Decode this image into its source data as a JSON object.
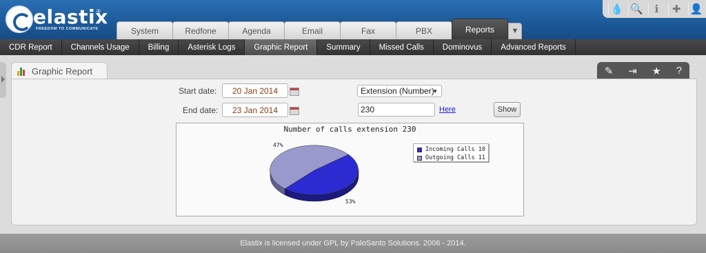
{
  "brand": {
    "name": "elastix",
    "reg": "®",
    "tagline": "FREEDOM TO COMMUNICATE"
  },
  "tools": [
    {
      "name": "drop-icon",
      "glyph": "💧"
    },
    {
      "name": "search-icon",
      "glyph": "🔍"
    },
    {
      "name": "info-icon",
      "glyph": "ℹ"
    },
    {
      "name": "puzzle-icon",
      "glyph": "✚"
    },
    {
      "name": "user-icon",
      "glyph": "👤"
    }
  ],
  "tabs": [
    "System",
    "Redfone",
    "Agenda",
    "Email",
    "Fax",
    "PBX",
    "Reports"
  ],
  "active_tab": "Reports",
  "submenu": [
    "CDR Report",
    "Channels Usage",
    "Billing",
    "Asterisk Logs",
    "Graphic Report",
    "Summary",
    "Missed Calls",
    "Dominovus",
    "Advanced Reports"
  ],
  "active_submenu": "Graphic Report",
  "module": {
    "title": "Graphic Report"
  },
  "actions": [
    {
      "name": "edit-icon",
      "glyph": "✎"
    },
    {
      "name": "export-icon",
      "glyph": "⇥"
    },
    {
      "name": "star-icon",
      "glyph": "★"
    },
    {
      "name": "help-icon",
      "glyph": "?"
    }
  ],
  "form": {
    "start_label": "Start date:",
    "start_value": "20 Jan 2014",
    "end_label": "End date:",
    "end_value": "23 Jan 2014",
    "type_select": "Extension (Number)",
    "extension_value": "230",
    "here_link": "Here",
    "show_button": "Show"
  },
  "chart_data": {
    "type": "pie",
    "title": "Number of calls extension 230",
    "categories": [
      "Incoming Calls 10",
      "Outgoing Calls 11"
    ],
    "values": [
      10,
      11
    ],
    "labels": [
      "47%",
      "53%"
    ],
    "colors": [
      "#2b2bd1",
      "#9999cc"
    ],
    "legend": "right"
  },
  "footer": "Elastix is licensed under GPL by PaloSanto Solutions. 2006 - 2014."
}
